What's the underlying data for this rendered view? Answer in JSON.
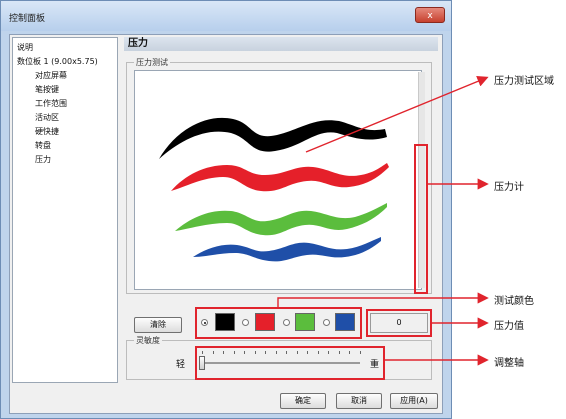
{
  "window": {
    "title": "控制面板",
    "close_symbol": "x"
  },
  "sidebar": {
    "items": [
      {
        "label": "说明",
        "indent": 0
      },
      {
        "label": "数位板  1 (9.00x5.75)",
        "indent": 0
      },
      {
        "label": "对应屏幕",
        "indent": 1
      },
      {
        "label": "笔按键",
        "indent": 1
      },
      {
        "label": "工作范围",
        "indent": 1
      },
      {
        "label": "活动区",
        "indent": 1
      },
      {
        "label": "硬快捷",
        "indent": 1
      },
      {
        "label": "转盘",
        "indent": 1
      },
      {
        "label": "压力",
        "indent": 1
      }
    ]
  },
  "panel": {
    "title": "压力",
    "test_group_label": "压力测试",
    "clear_button": "清除",
    "pressure_value": "0",
    "sensitivity_label": "灵敏度",
    "slider_min_label": "轻",
    "slider_max_label": "重",
    "slider_value": 0
  },
  "colors": {
    "options": [
      {
        "name": "black",
        "hex": "#000000",
        "selected": true
      },
      {
        "name": "red",
        "hex": "#e5202a",
        "selected": false
      },
      {
        "name": "green",
        "hex": "#5bbd3d",
        "selected": false
      },
      {
        "name": "blue",
        "hex": "#1f4fa8",
        "selected": false
      }
    ]
  },
  "footer": {
    "ok": "确定",
    "cancel": "取消",
    "apply": "应用(A)"
  },
  "annotations": {
    "test_area": "压力测试区域",
    "gauge": "压力计",
    "test_color": "测试颜色",
    "pressure_value": "压力值",
    "slider": "调整轴",
    "annotation_color": "#e0242d"
  }
}
